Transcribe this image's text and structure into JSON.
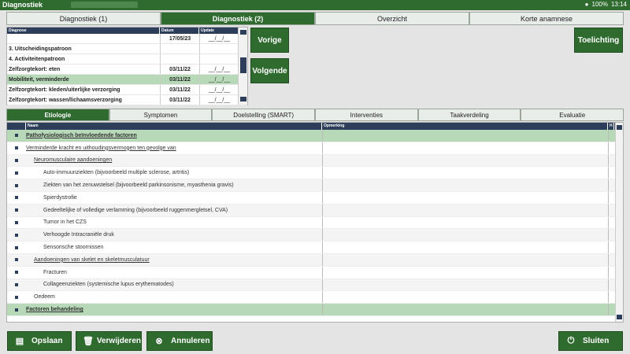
{
  "app": {
    "title": "Diagnostiek",
    "time": "13:14",
    "battery": "100%"
  },
  "main_tabs": [
    "Diagnostiek (1)",
    "Diagnostiek (2)",
    "Overzicht",
    "Korte anamnese"
  ],
  "diag_table": {
    "headers": [
      "Diagnose",
      "Datum",
      "Update"
    ],
    "rows": [
      {
        "name": "",
        "date": "17/05/23",
        "update": "__/__/__"
      },
      {
        "name": "3. Uitscheidingspatroon",
        "date": "",
        "update": ""
      },
      {
        "name": "4. Activiteitenpatroon",
        "date": "",
        "update": ""
      },
      {
        "name": "Zelfzorgtekort: eten",
        "date": "03/11/22",
        "update": "__/__/__"
      },
      {
        "name": "Mobiliteit, verminderde",
        "date": "03/11/22",
        "update": "__/__/__"
      },
      {
        "name": "Zelfzorgtekort: kleden/uiterlijke verzorging",
        "date": "03/11/22",
        "update": "__/__/__"
      },
      {
        "name": "Zelfzorgtekort: wassen/lichaamsverzorging",
        "date": "03/11/22",
        "update": "__/__/__"
      }
    ]
  },
  "buttons": {
    "prev": "Vorige",
    "next": "Volgende",
    "toelichting": "Toelichting"
  },
  "sub_tabs": [
    "Etiologie",
    "Symptomen",
    "Doelstelling (SMART)",
    "Interventies",
    "Taakverdeling",
    "Evaluatie"
  ],
  "grid": {
    "headers": [
      "Naam",
      "Opmerking",
      "H"
    ],
    "rows": [
      {
        "name": "Pathofysiologisch beïnvloedende factoren",
        "head": true,
        "indent": 0
      },
      {
        "name": "Verminderde kracht en uithoudingsvermogen ten gevolge van",
        "head": false,
        "indent": 0,
        "ul": true
      },
      {
        "name": "Neuromusculaire aandoeningen",
        "head": false,
        "indent": 1,
        "ul": true
      },
      {
        "name": "Auto-immuunziekten (bijvoorbeeld multiple sclerose, artritis)",
        "head": false,
        "indent": 2
      },
      {
        "name": "Ziekten van het zenuwstelsel (bijvoorbeeld parkinsonisme, myasthenia gravis)",
        "head": false,
        "indent": 2
      },
      {
        "name": "Spierdystrofie",
        "head": false,
        "indent": 2
      },
      {
        "name": "Gedeeltelijke of volledige verlamming (bijvoorbeeld ruggenmergletsel, CVA)",
        "head": false,
        "indent": 2
      },
      {
        "name": "Tumor in het CZS",
        "head": false,
        "indent": 2
      },
      {
        "name": "Verhoogde Intracraniële druk",
        "head": false,
        "indent": 2
      },
      {
        "name": "Sensorische stoornissen",
        "head": false,
        "indent": 2
      },
      {
        "name": "Aandoeningen van skelet en skeletmusculatuur",
        "head": false,
        "indent": 1,
        "ul": true
      },
      {
        "name": "Fracturen",
        "head": false,
        "indent": 2
      },
      {
        "name": "Collageenziekten (systemische lupus erythematodes)",
        "head": false,
        "indent": 2
      },
      {
        "name": "Oedeem",
        "head": false,
        "indent": 1
      },
      {
        "name": "Factoren behandeling",
        "head": true,
        "indent": 0
      }
    ]
  },
  "footer": {
    "save": "Opslaan",
    "delete": "Verwijderen",
    "cancel": "Annuleren",
    "close": "Sluiten"
  },
  "colors": {
    "primary": "#2f6b2f",
    "header": "#2c3e5a",
    "selected": "#b8d9b8"
  }
}
